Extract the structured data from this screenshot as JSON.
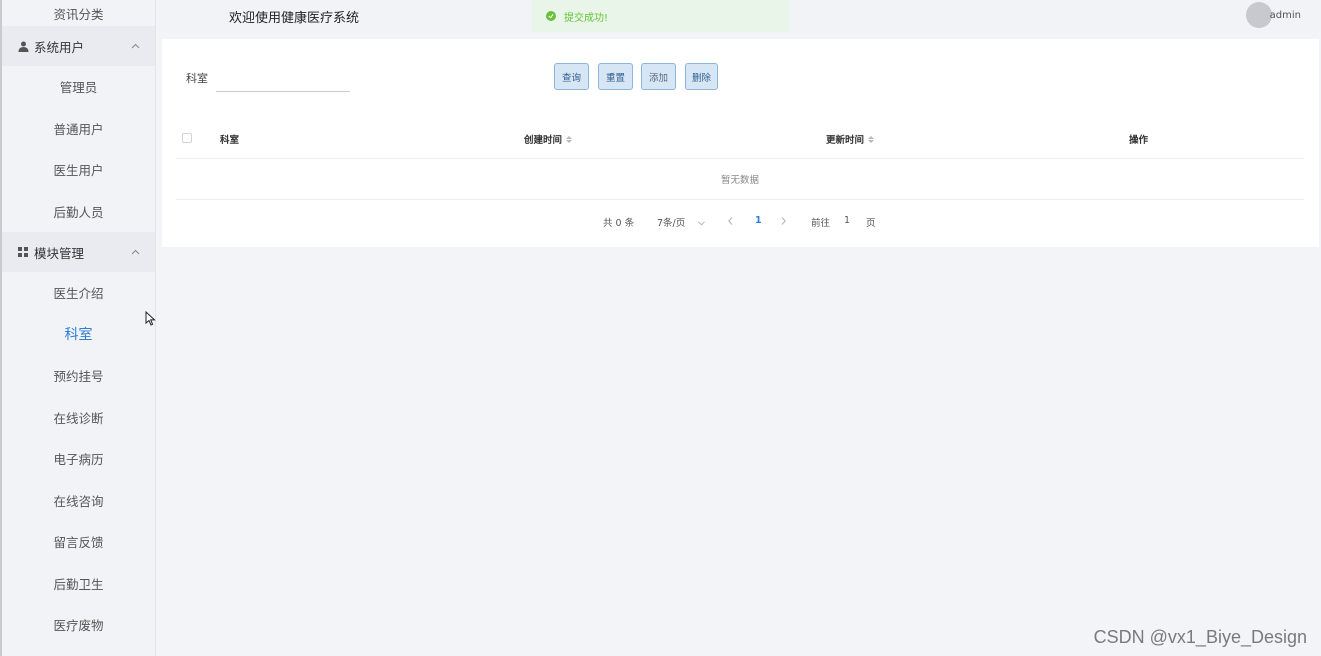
{
  "sidebar": {
    "top_item": "资讯分类",
    "group_users": {
      "label": "系统用户",
      "items": [
        "管理员",
        "普通用户",
        "医生用户",
        "后勤人员"
      ]
    },
    "group_modules": {
      "label": "模块管理",
      "items": [
        "医生介绍",
        "科室",
        "预约挂号",
        "在线诊断",
        "电子病历",
        "在线咨询",
        "留言反馈",
        "后勤卫生",
        "医疗废物"
      ]
    }
  },
  "header": {
    "title": "欢迎使用健康医疗系统",
    "toast": "提交成功!",
    "user": "admin"
  },
  "search": {
    "label": "科室",
    "value": ""
  },
  "buttons": {
    "query": "查询",
    "reset": "重置",
    "add": "添加",
    "delete": "删除"
  },
  "table": {
    "columns": [
      "科室",
      "创建时间",
      "更新时间",
      "操作"
    ],
    "empty_text": "暂无数据"
  },
  "pagination": {
    "total": "共 0 条",
    "page_size": "7条/页",
    "current_page": "1",
    "goto_prefix": "前往",
    "goto_value": "1",
    "goto_suffix": "页"
  },
  "watermark": "CSDN @vx1_Biye_Design",
  "colors": {
    "accent": "#2e7fd3",
    "success": "#67c23a",
    "button_bg": "#d7e6f5"
  }
}
